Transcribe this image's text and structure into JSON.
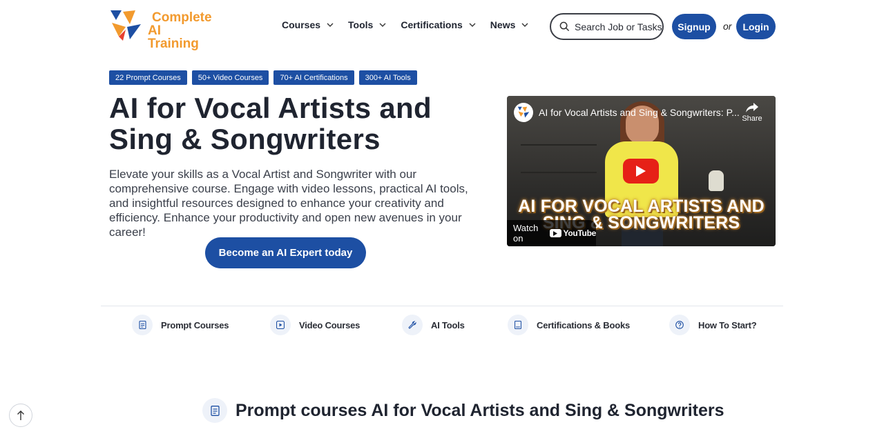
{
  "brand": {
    "line1": "Complete",
    "line2": "AI Training"
  },
  "nav": [
    {
      "label": "Courses"
    },
    {
      "label": "Tools"
    },
    {
      "label": "Certifications"
    },
    {
      "label": "News"
    }
  ],
  "search": {
    "placeholder": "Search Job or Tasks"
  },
  "auth": {
    "signup": "Signup",
    "or": "or",
    "login": "Login"
  },
  "badges": [
    "22 Prompt Courses",
    "50+ Video Courses",
    "70+ AI Certifications",
    "300+ AI Tools"
  ],
  "hero": {
    "title": "AI for Vocal Artists and Sing & Songwriters",
    "description": "Elevate your skills as a Vocal Artist and Songwriter with our comprehensive course. Engage with video lessons, practical AI tools, and insightful resources designed to enhance your creativity and efficiency. Enhance your productivity and open new avenues in your career!",
    "cta": "Become an AI Expert today"
  },
  "video": {
    "title": "AI for Vocal Artists and Sing & Songwriters: P...",
    "share": "Share",
    "overlay_line1": "AI FOR VOCAL ARTISTS AND",
    "overlay_line2": "SING & SONGWRITERS",
    "watch_on": "Watch on",
    "platform": "YouTube"
  },
  "quick_links": [
    {
      "label": "Prompt Courses",
      "icon": "document-icon"
    },
    {
      "label": "Video Courses",
      "icon": "play-icon"
    },
    {
      "label": "AI Tools",
      "icon": "wrench-icon"
    },
    {
      "label": "Certifications & Books",
      "icon": "book-icon"
    },
    {
      "label": "How To Start?",
      "icon": "question-icon"
    }
  ],
  "section": {
    "title": "Prompt courses AI for Vocal Artists and Sing & Songwriters",
    "icon": "document-icon"
  },
  "colors": {
    "primary": "#1d4fa3",
    "brand_orange": "#f29a2e",
    "text": "#1f2430"
  }
}
